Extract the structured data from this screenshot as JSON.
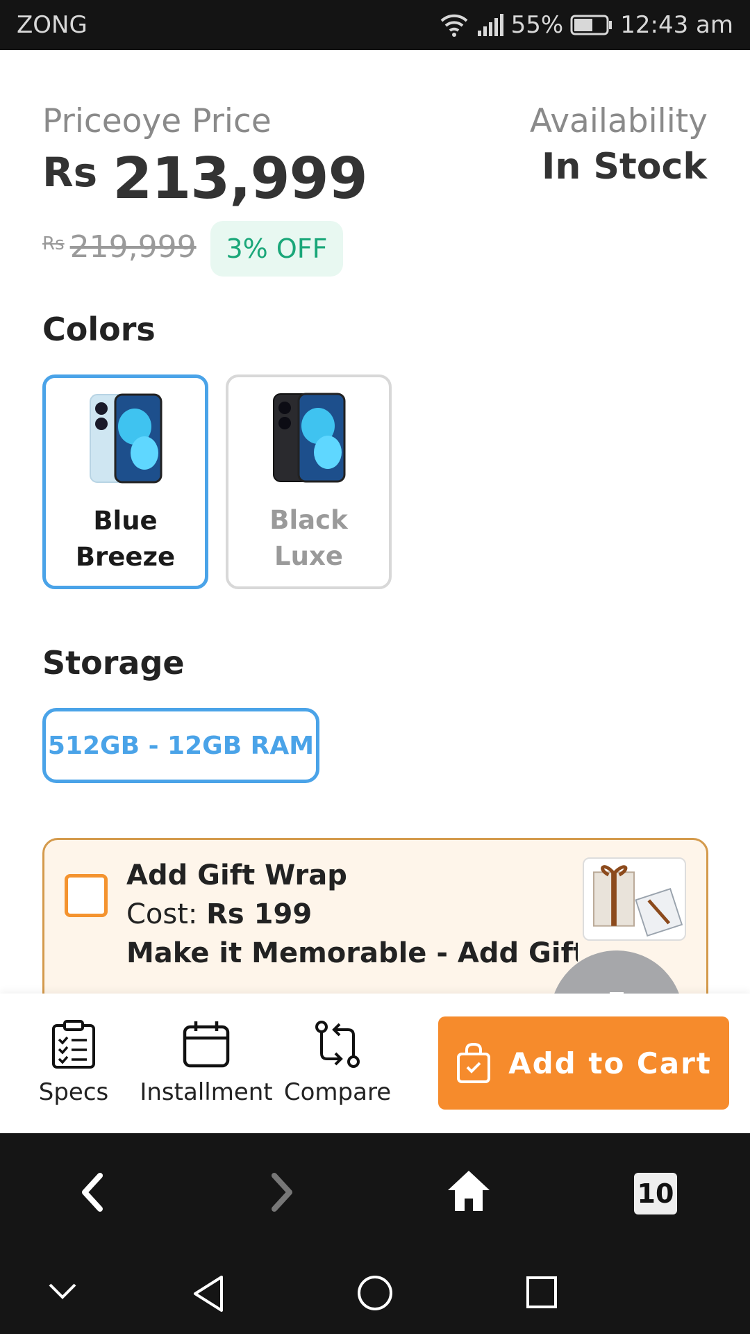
{
  "status_bar": {
    "carrier": "ZONG",
    "battery": "55%",
    "time": "12:43 am"
  },
  "price": {
    "label": "Priceoye Price",
    "currency": "Rs",
    "value": "213,999",
    "old_currency": "Rs",
    "old_value": "219,999",
    "discount": "3% OFF"
  },
  "availability": {
    "label": "Availability",
    "value": "In Stock"
  },
  "colors": {
    "title": "Colors",
    "options": [
      {
        "name": "Blue Breeze",
        "selected": true,
        "body_color": "#cfe6f2"
      },
      {
        "name": "Black Luxe",
        "selected": false,
        "body_color": "#2a2a2e"
      }
    ]
  },
  "storage": {
    "title": "Storage",
    "options": [
      {
        "label": "512GB - 12GB RAM",
        "selected": true
      }
    ]
  },
  "gift_wrap": {
    "title": "Add Gift Wrap",
    "cost_label": "Cost:",
    "cost_value": "Rs 199",
    "description": "Make it Memorable - Add Gift ...",
    "checked": false
  },
  "fab": {
    "icon": "download-icon"
  },
  "bottom_bar": {
    "specs": "Specs",
    "installment": "Installment",
    "compare": "Compare",
    "add_to_cart": "Add to Cart"
  },
  "browser_nav": {
    "tab_count": "10"
  },
  "colors_theme": {
    "accent_blue": "#4aa3e8",
    "accent_orange": "#f68b2c",
    "discount_green": "#1aa779"
  }
}
